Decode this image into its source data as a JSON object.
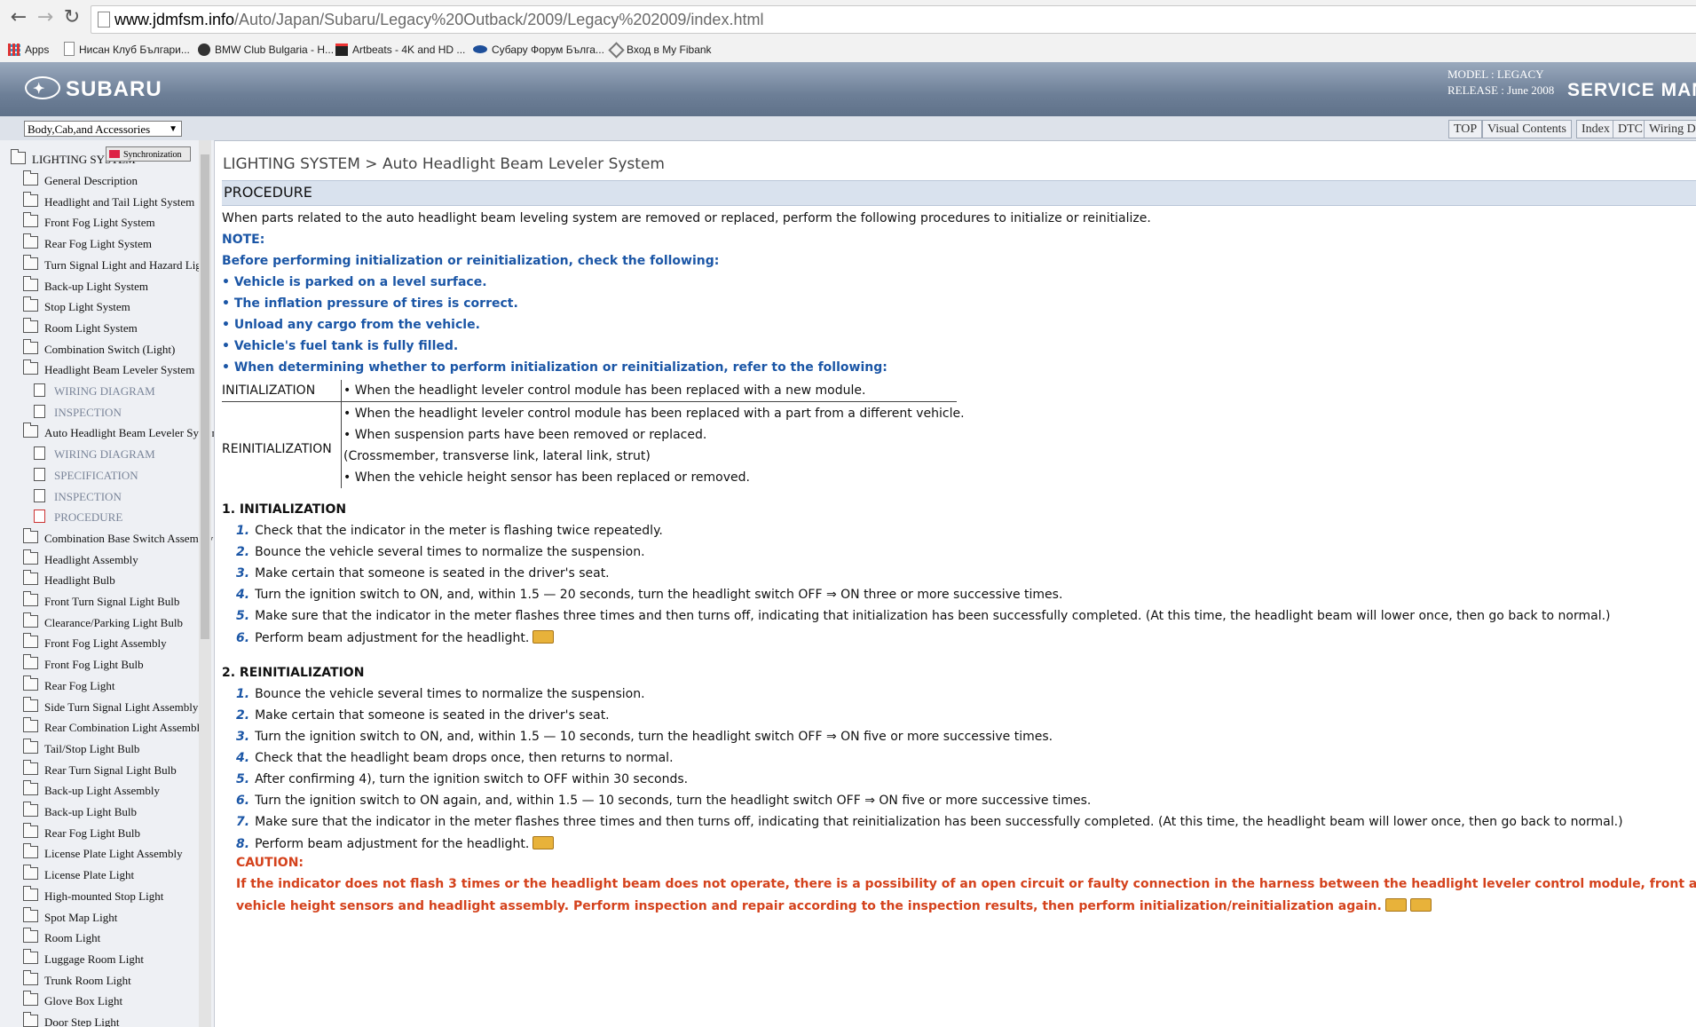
{
  "browser": {
    "url_domain": "www.jdmfsm.info",
    "url_path": "/Auto/Japan/Subaru/Legacy%20Outback/2009/Legacy%202009/index.html",
    "bookmarks": [
      "Apps",
      "Нисан Клуб Българи...",
      "BMW Club Bulgaria - H...",
      "Artbeats - 4K and HD ...",
      "Субару Форум Бълга...",
      "Вход в My Fibank"
    ]
  },
  "header": {
    "brand": "SUBARU",
    "model": "MODEL : LEGACY",
    "release": "RELEASE : June 2008",
    "title": "SERVICE MAN"
  },
  "toolbar": {
    "category": "Body,Cab,and Accessories",
    "tabs": [
      "TOP",
      "Visual Contents",
      "Index",
      "DTC",
      "Wiring D"
    ]
  },
  "sidebar": {
    "sync_label": "Synchronization",
    "root": "LIGHTING SYSTEM",
    "items": [
      "General Description",
      "Headlight and Tail Light System",
      "Front Fog Light System",
      "Rear Fog Light System",
      "Turn Signal Light and Hazard Light",
      "Back-up Light System",
      "Stop Light System",
      "Room Light System",
      "Combination Switch (Light)",
      "Headlight Beam Leveler System",
      "WIRING DIAGRAM",
      "INSPECTION",
      "Auto Headlight Beam Leveler System",
      "WIRING DIAGRAM",
      "SPECIFICATION",
      "INSPECTION",
      "PROCEDURE",
      "Combination Base Switch Assembly",
      "Headlight Assembly",
      "Headlight Bulb",
      "Front Turn Signal Light Bulb",
      "Clearance/Parking Light Bulb",
      "Front Fog Light Assembly",
      "Front Fog Light Bulb",
      "Rear Fog Light",
      "Side Turn Signal Light Assembly",
      "Rear Combination Light Assembly",
      "Tail/Stop Light Bulb",
      "Rear Turn Signal Light Bulb",
      "Back-up Light Assembly",
      "Back-up Light Bulb",
      "Rear Fog Light Bulb",
      "License Plate Light Assembly",
      "License Plate Light",
      "High-mounted Stop Light",
      "Spot Map Light",
      "Room Light",
      "Luggage Room Light",
      "Trunk Room Light",
      "Glove Box Light",
      "Door Step Light"
    ]
  },
  "content": {
    "breadcrumb": "LIGHTING SYSTEM > Auto Headlight Beam Leveler System",
    "section": "PROCEDURE",
    "intro": "When parts related to the auto headlight beam leveling system are removed or replaced, perform the following procedures to initialize or reinitialize.",
    "note_label": "NOTE:",
    "note_heading": "Before performing initialization or reinitialization, check the following:",
    "note_items": [
      "• Vehicle is parked on a level surface.",
      "• The inflation pressure of tires is correct.",
      "• Unload any cargo from the vehicle.",
      "• Vehicle's fuel tank is fully filled.",
      "• When determining whether to perform initialization or reinitialization, refer to the following:"
    ],
    "table": {
      "init_label": "INITIALIZATION",
      "init_text": "• When the headlight leveler control module has been replaced with a new module.",
      "reinit_label": "REINITIALIZATION",
      "reinit_lines": [
        "• When the headlight leveler control module has been replaced with a part from a different vehicle.",
        "• When suspension parts have been removed or replaced.",
        "(Crossmember, transverse link, lateral link, strut)",
        "• When the vehicle height sensor has been replaced or removed."
      ]
    },
    "init_heading": "1. INITIALIZATION",
    "init_steps": [
      {
        "n": "1.",
        "t": "Check that the indicator in the meter is flashing twice repeatedly."
      },
      {
        "n": "2.",
        "t": "Bounce the vehicle several times to normalize the suspension."
      },
      {
        "n": "3.",
        "t": "Make certain that someone is seated in the driver's seat."
      },
      {
        "n": "4.",
        "t": "Turn the ignition switch to ON, and, within 1.5 — 20 seconds, turn the headlight switch OFF ⇒ ON three or more successive times."
      },
      {
        "n": "5.",
        "t": "Make sure that the indicator in the meter flashes three times and then turns off, indicating that initialization has been successfully completed. (At this time, the headlight beam will lower once, then go back to normal.)"
      },
      {
        "n": "6.",
        "t": "Perform beam adjustment for the headlight."
      }
    ],
    "reinit_heading": "2. REINITIALIZATION",
    "reinit_steps": [
      {
        "n": "1.",
        "t": "Bounce the vehicle several times to normalize the suspension."
      },
      {
        "n": "2.",
        "t": "Make certain that someone is seated in the driver's seat."
      },
      {
        "n": "3.",
        "t": "Turn the ignition switch to ON, and, within 1.5 — 10 seconds, turn the headlight switch OFF ⇒ ON five or more successive times."
      },
      {
        "n": "4.",
        "t": "Check that the headlight beam drops once, then returns to normal."
      },
      {
        "n": "5.",
        "t": "After confirming 4), turn the ignition switch to OFF within 30 seconds."
      },
      {
        "n": "6.",
        "t": "Turn the ignition switch to ON again, and, within 1.5 — 10 seconds, turn the headlight switch OFF ⇒ ON five or more successive times."
      },
      {
        "n": "7.",
        "t": "Make sure that the indicator in the meter flashes three times and then turns off, indicating that reinitialization has been successfully completed. (At this time, the headlight beam will lower once, then go back to normal.)"
      },
      {
        "n": "8.",
        "t": "Perform beam adjustment for the headlight."
      }
    ],
    "caution_label": "CAUTION:",
    "caution_line1": "If the indicator does not flash 3 times or the headlight beam does not operate, there is a possibility of an open circuit or faulty connection in the harness between the headlight leveler control module, front and rear",
    "caution_line2": "vehicle height sensors and headlight assembly. Perform inspection and repair according to the inspection results, then perform initialization/reinitialization again."
  },
  "colors": {
    "header": "#6d7f97",
    "note_blue": "#1b56a6",
    "caution_red": "#d4421c",
    "section_bar": "#d9e2ee"
  }
}
